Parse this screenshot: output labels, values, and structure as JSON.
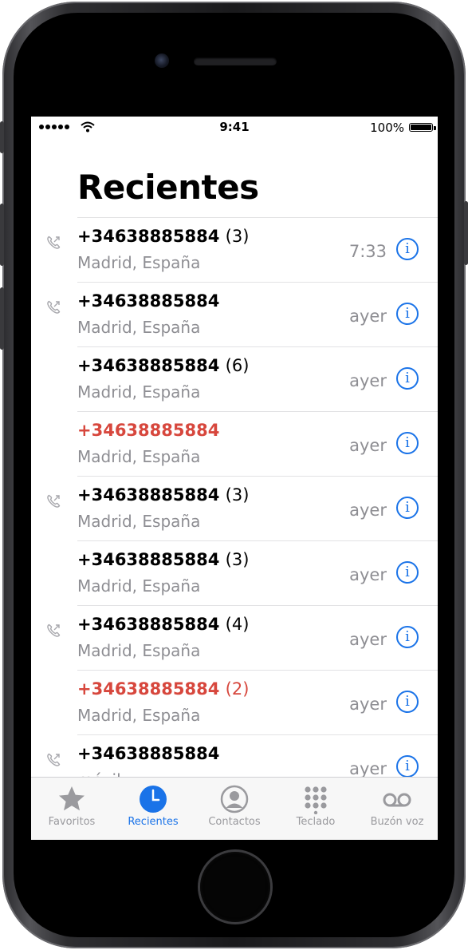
{
  "status_bar": {
    "time": "9:41",
    "battery": "100%"
  },
  "header": {
    "title": "Recientes"
  },
  "calls": [
    {
      "number": "+34638885884",
      "count": "(3)",
      "subtitle": "Madrid, España",
      "when": "7:33",
      "outgoing": true,
      "missed": false
    },
    {
      "number": "+34638885884",
      "count": "",
      "subtitle": "Madrid, España",
      "when": "ayer",
      "outgoing": true,
      "missed": false
    },
    {
      "number": "+34638885884",
      "count": "(6)",
      "subtitle": "Madrid, España",
      "when": "ayer",
      "outgoing": false,
      "missed": false
    },
    {
      "number": "+34638885884",
      "count": "",
      "subtitle": "Madrid, España",
      "when": "ayer",
      "outgoing": false,
      "missed": true
    },
    {
      "number": "+34638885884",
      "count": "(3)",
      "subtitle": "Madrid, España",
      "when": "ayer",
      "outgoing": true,
      "missed": false
    },
    {
      "number": "+34638885884",
      "count": "(3)",
      "subtitle": "Madrid, España",
      "when": "ayer",
      "outgoing": false,
      "missed": false
    },
    {
      "number": "+34638885884",
      "count": "(4)",
      "subtitle": "Madrid, España",
      "when": "ayer",
      "outgoing": true,
      "missed": false
    },
    {
      "number": "+34638885884",
      "count": "(2)",
      "subtitle": "Madrid, España",
      "when": "ayer",
      "outgoing": false,
      "missed": true
    },
    {
      "number": "+34638885884",
      "count": "",
      "subtitle": "móvil",
      "when": "ayer",
      "outgoing": true,
      "missed": false
    }
  ],
  "tabs": [
    {
      "label": "Favoritos",
      "icon": "star-icon",
      "active": false
    },
    {
      "label": "Recientes",
      "icon": "clock-icon",
      "active": true
    },
    {
      "label": "Contactos",
      "icon": "person-circle-icon",
      "active": false
    },
    {
      "label": "Teclado",
      "icon": "keypad-icon",
      "active": false
    },
    {
      "label": "Buzón voz",
      "icon": "voicemail-icon",
      "active": false
    }
  ],
  "colors": {
    "accent": "#1a73e8",
    "missed": "#d7473d",
    "secondary_text": "#8e8e93",
    "tab_inactive": "#9a9a9e"
  }
}
